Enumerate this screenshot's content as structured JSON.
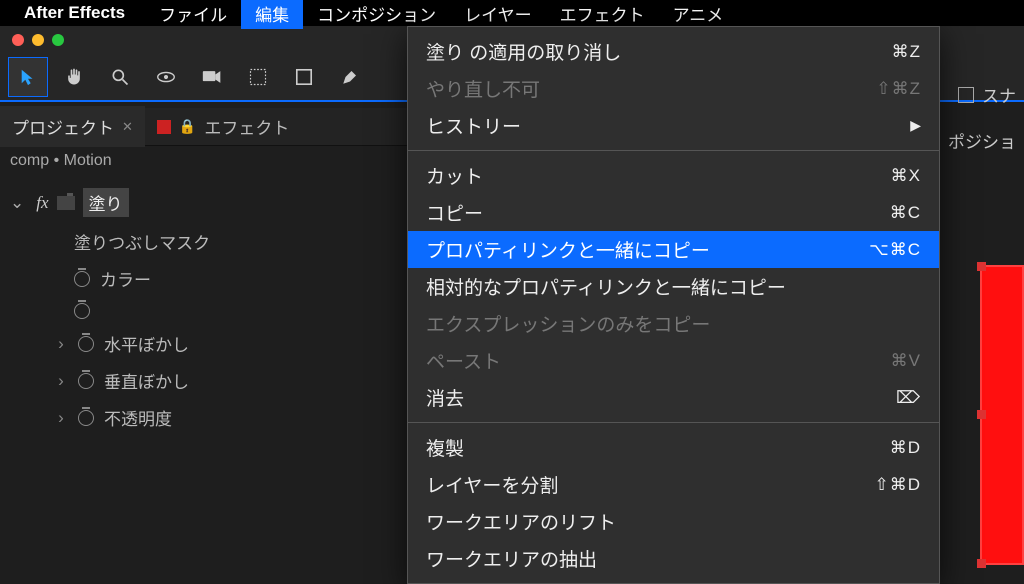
{
  "menubar": {
    "app": "After Effects",
    "items": [
      "ファイル",
      "編集",
      "コンポジション",
      "レイヤー",
      "エフェクト",
      "アニメ"
    ],
    "activeIndex": 1
  },
  "toolbar": {
    "snapLabel": "スナ"
  },
  "panels": {
    "project": "プロジェクト",
    "effects": "エフェクト",
    "rightComp": "ポジショ"
  },
  "effectPanel": {
    "path": "comp • Motion",
    "effectName": "塗り",
    "props": {
      "fillMask": "塗りつぶしマスク",
      "color": "カラー",
      "hBlur": "水平ぼかし",
      "vBlur": "垂直ぼかし",
      "opacity": "不透明度"
    }
  },
  "editMenu": {
    "undo": {
      "label": "塗り の適用の取り消し",
      "shortcut": "⌘Z"
    },
    "redo": {
      "label": "やり直し不可",
      "shortcut": "⇧⌘Z"
    },
    "history": {
      "label": "ヒストリー"
    },
    "cut": {
      "label": "カット",
      "shortcut": "⌘X"
    },
    "copy": {
      "label": "コピー",
      "shortcut": "⌘C"
    },
    "copyLink": {
      "label": "プロパティリンクと一緒にコピー",
      "shortcut": "⌥⌘C"
    },
    "copyRelLink": {
      "label": "相対的なプロパティリンクと一緒にコピー"
    },
    "copyExpr": {
      "label": "エクスプレッションのみをコピー"
    },
    "paste": {
      "label": "ペースト",
      "shortcut": "⌘V"
    },
    "clear": {
      "label": "消去",
      "shortcut": "⌦"
    },
    "duplicate": {
      "label": "複製",
      "shortcut": "⌘D"
    },
    "split": {
      "label": "レイヤーを分割",
      "shortcut": "⇧⌘D"
    },
    "lift": {
      "label": "ワークエリアのリフト"
    },
    "extract": {
      "label": "ワークエリアの抽出"
    }
  }
}
